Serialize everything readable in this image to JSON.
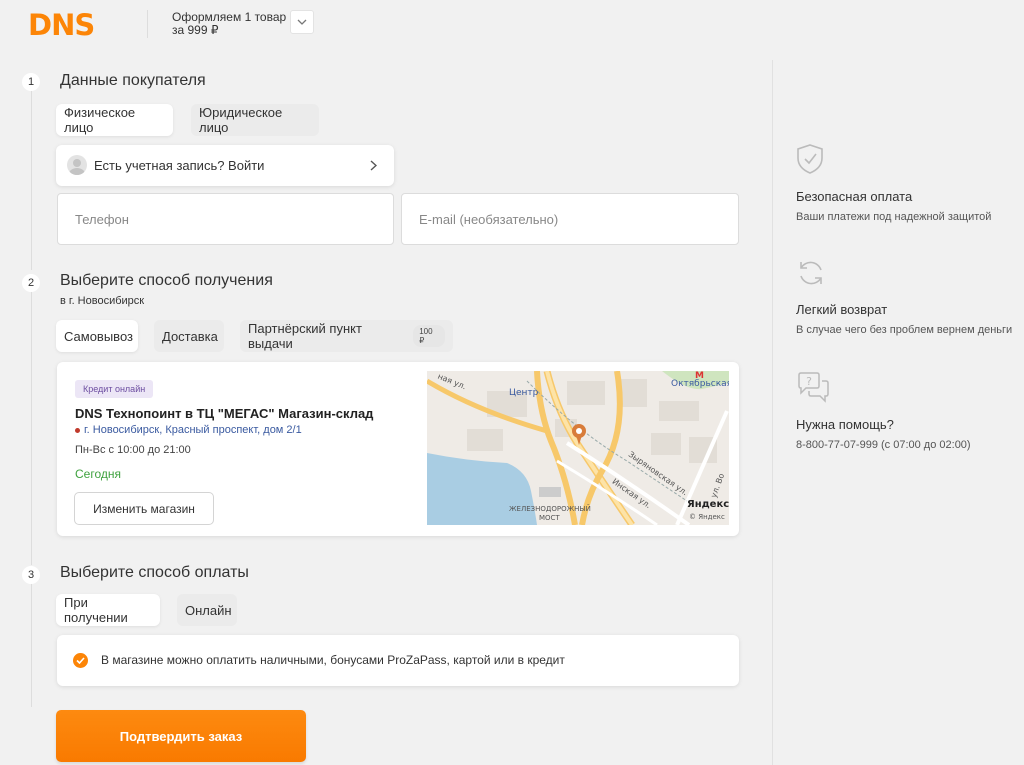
{
  "header": {
    "logo": "DNS",
    "order_line1": "Оформляем 1 товар",
    "order_line2": "за 999 ₽"
  },
  "steps": [
    {
      "number": "1",
      "title": "Данные покупателя"
    },
    {
      "number": "2",
      "title": "Выберите способ получения",
      "subtitle": "в г. Новосибирск"
    },
    {
      "number": "3",
      "title": "Выберите способ оплаты"
    }
  ],
  "buyer": {
    "tabs": [
      "Физическое лицо",
      "Юридическое лицо"
    ],
    "login_text": "Есть учетная запись? Войти",
    "phone_placeholder": "Телефон",
    "email_placeholder": "E-mail (необязательно)"
  },
  "delivery": {
    "tabs": [
      "Самовывоз",
      "Доставка",
      "Партнёрский пункт выдачи"
    ],
    "partner_price": "100 ₽",
    "store": {
      "badge": "Кредит онлайн",
      "name": "DNS Технопоинт в ТЦ \"МЕГАС\" Магазин-склад",
      "address": "г. Новосибирск, Красный проспект, дом 2/1",
      "hours": "Пн-Вс с 10:00 до 21:00",
      "availability": "Сегодня",
      "change_button": "Изменить магазин"
    },
    "map_labels": {
      "street1": "ная ул.",
      "centre": "Центр",
      "station": "Октябрьская",
      "street2": "Зыряновская ул.",
      "street3": "Инская ул.",
      "street4": "ул. Во",
      "bridge1": "ЖЕЛЕЗНОДОРОЖНЫЙ",
      "bridge2": "МОСТ",
      "brand": "Яндекс",
      "brand_small": "© Яндекс",
      "metro": "М"
    }
  },
  "payment": {
    "tabs": [
      "При получении",
      "Онлайн"
    ],
    "info": "В магазине можно оплатить наличными, бонусами ProZaPass, картой или в кредит"
  },
  "confirm_button": "Подтвердить заказ",
  "sidebar": [
    {
      "icon": "shield-check-icon",
      "title": "Безопасная оплата",
      "desc": "Ваши платежи под надежной защитой"
    },
    {
      "icon": "refresh-icon",
      "title": "Легкий возврат",
      "desc": "В случае чего без проблем вернем деньги"
    },
    {
      "icon": "chat-question-icon",
      "title": "Нужна помощь?",
      "desc": "8-800-77-07-999 (с 07:00 до 02:00)"
    }
  ],
  "colors": {
    "brand": "#fc8507",
    "link": "#3a5aa0",
    "success": "#3fa23f"
  }
}
